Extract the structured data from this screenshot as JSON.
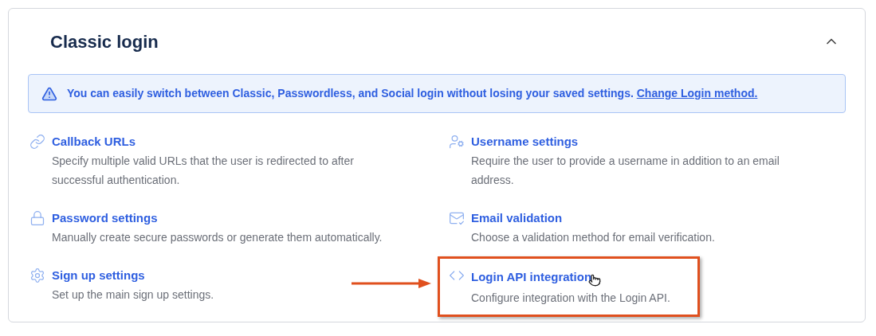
{
  "section": {
    "title": "Classic login",
    "expanded": true
  },
  "alert": {
    "text": "You can easily switch between Classic, Passwordless, and Social login without losing your saved settings.",
    "link": "Change Login method."
  },
  "items": [
    {
      "title": "Callback URLs",
      "description": "Specify multiple valid URLs that the user is redirected to after successful authentication.",
      "highlighted": false
    },
    {
      "title": "Username settings",
      "description": "Require the user to provide a username in addition to an email address.",
      "highlighted": false
    },
    {
      "title": "Password settings",
      "description": "Manually create secure passwords or generate them automatically.",
      "highlighted": false
    },
    {
      "title": "Email validation",
      "description": "Choose a validation method for email verification.",
      "highlighted": false
    },
    {
      "title": "Sign up settings",
      "description": "Set up the main sign up settings.",
      "highlighted": false
    },
    {
      "title": "Login API integration",
      "description": "Configure integration with the Login API.",
      "highlighted": true
    }
  ]
}
